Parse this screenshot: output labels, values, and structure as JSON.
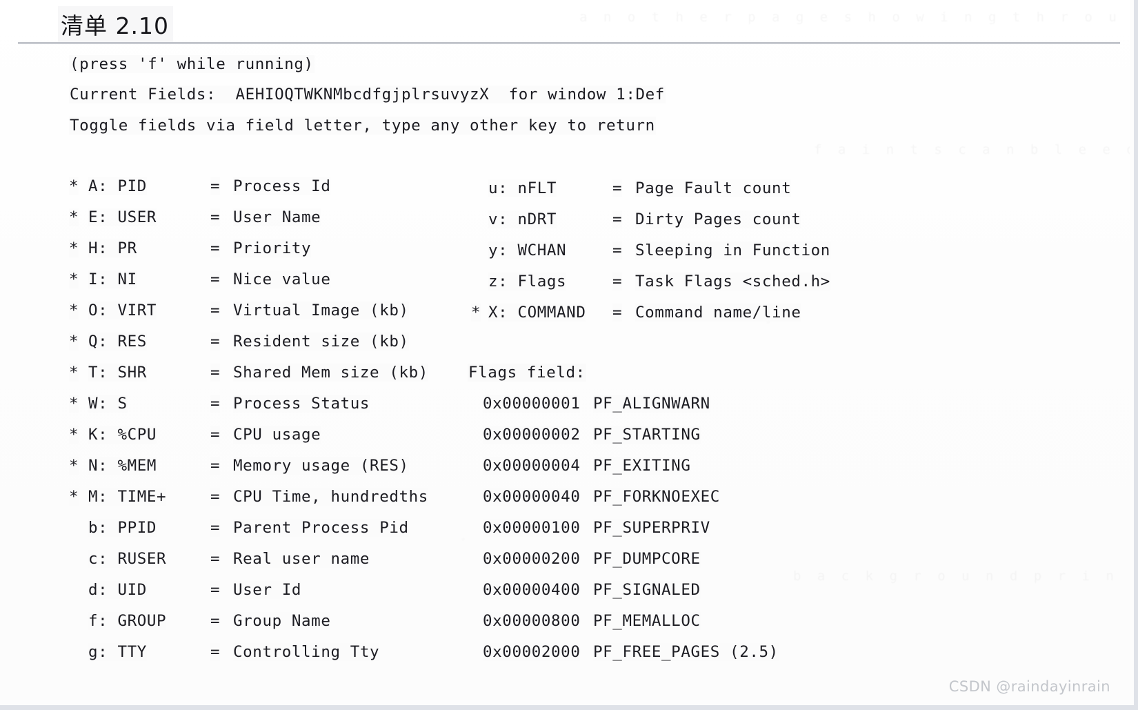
{
  "document": {
    "title": "清单 2.10",
    "watermark": "CSDN @raindayinrain"
  },
  "terminal": {
    "header_lines": [
      "(press 'f' while running)",
      "Current Fields:  AEHIOQTWKNMbcdfgjplrsuvyzX  for window 1:Def",
      "Toggle fields via field letter, type any other key to return"
    ],
    "flags_heading": "Flags field:",
    "left_fields": [
      {
        "star": "*",
        "key": "A: PID",
        "eq": "=",
        "desc": "Process Id"
      },
      {
        "star": "*",
        "key": "E: USER",
        "eq": "=",
        "desc": "User Name"
      },
      {
        "star": "*",
        "key": "H: PR",
        "eq": "=",
        "desc": "Priority"
      },
      {
        "star": "*",
        "key": "I: NI",
        "eq": "=",
        "desc": "Nice value"
      },
      {
        "star": "*",
        "key": "O: VIRT",
        "eq": "=",
        "desc": "Virtual Image (kb)"
      },
      {
        "star": "*",
        "key": "Q: RES",
        "eq": "=",
        "desc": "Resident size (kb)"
      },
      {
        "star": "*",
        "key": "T: SHR",
        "eq": "=",
        "desc": "Shared Mem size (kb)"
      },
      {
        "star": "*",
        "key": "W: S",
        "eq": "=",
        "desc": "Process Status"
      },
      {
        "star": "*",
        "key": "K: %CPU",
        "eq": "=",
        "desc": "CPU usage"
      },
      {
        "star": "*",
        "key": "N: %MEM",
        "eq": "=",
        "desc": "Memory usage (RES)"
      },
      {
        "star": "*",
        "key": "M: TIME+",
        "eq": "=",
        "desc": "CPU Time, hundredths"
      },
      {
        "star": "",
        "key": "b: PPID",
        "eq": "=",
        "desc": "Parent Process Pid"
      },
      {
        "star": "",
        "key": "c: RUSER",
        "eq": "=",
        "desc": "Real user name"
      },
      {
        "star": "",
        "key": "d: UID",
        "eq": "=",
        "desc": "User Id"
      },
      {
        "star": "",
        "key": "f: GROUP",
        "eq": "=",
        "desc": "Group Name"
      },
      {
        "star": "",
        "key": "g: TTY",
        "eq": "=",
        "desc": "Controlling Tty"
      }
    ],
    "right_fields": [
      {
        "star": "",
        "key": "u: nFLT",
        "eq": "=",
        "desc": "Page Fault count"
      },
      {
        "star": "",
        "key": "v: nDRT",
        "eq": "=",
        "desc": "Dirty Pages count"
      },
      {
        "star": "",
        "key": "y: WCHAN",
        "eq": "=",
        "desc": "Sleeping in Function"
      },
      {
        "star": "",
        "key": "z: Flags",
        "eq": "=",
        "desc": "Task Flags <sched.h>"
      },
      {
        "star": "*",
        "key": "X: COMMAND",
        "eq": "=",
        "desc": "Command name/line"
      }
    ],
    "flags": [
      {
        "hex": "0x00000001",
        "name": "PF_ALIGNWARN"
      },
      {
        "hex": "0x00000002",
        "name": "PF_STARTING"
      },
      {
        "hex": "0x00000004",
        "name": "PF_EXITING"
      },
      {
        "hex": "0x00000040",
        "name": "PF_FORKNOEXEC"
      },
      {
        "hex": "0x00000100",
        "name": "PF_SUPERPRIV"
      },
      {
        "hex": "0x00000200",
        "name": "PF_DUMPCORE"
      },
      {
        "hex": "0x00000400",
        "name": "PF_SIGNALED"
      },
      {
        "hex": "0x00000800",
        "name": "PF_MEMALLOC"
      },
      {
        "hex": "0x00002000",
        "name": "PF_FREE_PAGES (2.5)"
      }
    ]
  },
  "ghost_text": [
    "a n o t h e r   p a g e   s h o w i n g   t h r o u g h",
    "f a i n t   s c a n   b l e e d   t h r o u g h   t e x t",
    "b a c k g r o u n d   p r i n t   r e s i d u e   m a r k s"
  ]
}
